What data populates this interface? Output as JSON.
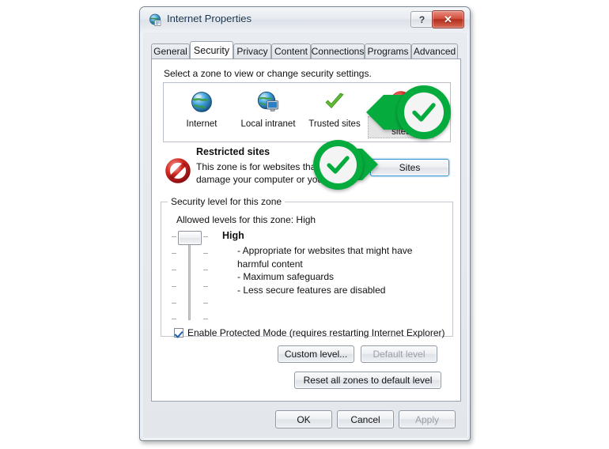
{
  "window": {
    "title": "Internet Properties",
    "icon": "internet-properties-icon",
    "help_label": "?",
    "close_label": "✕"
  },
  "tabs": [
    {
      "label": "General",
      "active": false
    },
    {
      "label": "Security",
      "active": true
    },
    {
      "label": "Privacy",
      "active": false
    },
    {
      "label": "Content",
      "active": false
    },
    {
      "label": "Connections",
      "active": false
    },
    {
      "label": "Programs",
      "active": false
    },
    {
      "label": "Advanced",
      "active": false
    }
  ],
  "security": {
    "hint": "Select a zone to view or change security settings.",
    "zones": [
      {
        "label": "Internet",
        "icon": "globe-icon",
        "selected": false
      },
      {
        "label": "Local intranet",
        "icon": "globe-monitor-icon",
        "selected": false
      },
      {
        "label": "Trusted sites",
        "icon": "green-check-icon",
        "selected": false
      },
      {
        "label": "Restricted sites",
        "icon": "red-prohibition-icon",
        "selected": true
      }
    ],
    "zone_detail": {
      "icon": "red-prohibition-icon",
      "title": "Restricted sites",
      "description": "This zone is for websites that might damage your computer or your files.",
      "sites_button": "Sites"
    },
    "level_group": {
      "legend": "Security level for this zone",
      "allowed": "Allowed levels for this zone: High",
      "current_level": "High",
      "bullets": [
        "- Appropriate for websites that might have harmful content",
        "- Maximum safeguards",
        "- Less secure features are disabled"
      ],
      "protected_mode": {
        "label": "Enable Protected Mode (requires restarting Internet Explorer)",
        "checked": true
      },
      "custom_level_button": "Custom level...",
      "default_level_button": "Default level",
      "default_level_disabled": true
    },
    "reset_button": "Reset all zones to default level"
  },
  "footer": {
    "ok": "OK",
    "cancel": "Cancel",
    "apply": "Apply",
    "apply_disabled": true
  },
  "annotations": [
    {
      "name": "restricted-sites-zone-callout",
      "icon": "green-check-badge",
      "direction": "left"
    },
    {
      "name": "sites-button-callout",
      "icon": "green-check-badge",
      "direction": "right"
    }
  ],
  "colors": {
    "accent_green": "#06ab3e",
    "close_red": "#b22e1d",
    "focus_blue": "#3c97d6"
  }
}
